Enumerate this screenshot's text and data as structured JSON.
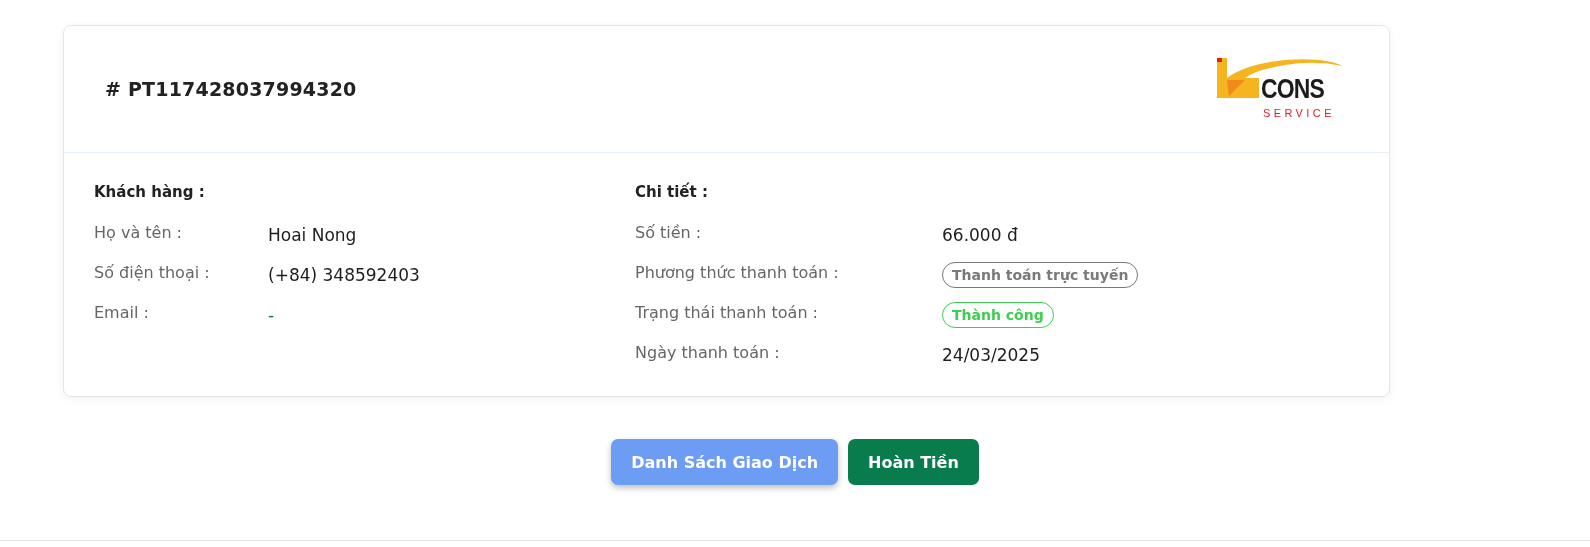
{
  "receipt": {
    "code": "# PT117428037994320"
  },
  "logo": {
    "text": "CONS",
    "subtext": "SERVICE"
  },
  "customer": {
    "heading": "Khách hàng :",
    "rows": [
      {
        "label": "Họ và tên :",
        "kind": "text",
        "value": "Hoai Nong"
      },
      {
        "label": "Số điện thoại :",
        "kind": "text",
        "value": "(+84) 348592403"
      },
      {
        "label": "Email :",
        "kind": "dash",
        "value": "-"
      }
    ]
  },
  "details": {
    "heading": "Chi tiết :",
    "rows": [
      {
        "label": "Số tiền :",
        "kind": "text",
        "value": "66.000 đ"
      },
      {
        "label": "Phương thức thanh toán :",
        "kind": "badge",
        "value": "Thanh toán trực tuyến",
        "color": "#7a7a7a"
      },
      {
        "label": "Trạng thái thanh toán :",
        "kind": "badge",
        "value": "Thành công",
        "color": "#3ccf4e"
      },
      {
        "label": "Ngày thanh toán :",
        "kind": "text",
        "value": "24/03/2025"
      }
    ]
  },
  "buttons": [
    {
      "label": "Danh Sách Giao Dịch",
      "kind": "secondary"
    },
    {
      "label": "Hoàn Tiền",
      "kind": "primary"
    }
  ]
}
